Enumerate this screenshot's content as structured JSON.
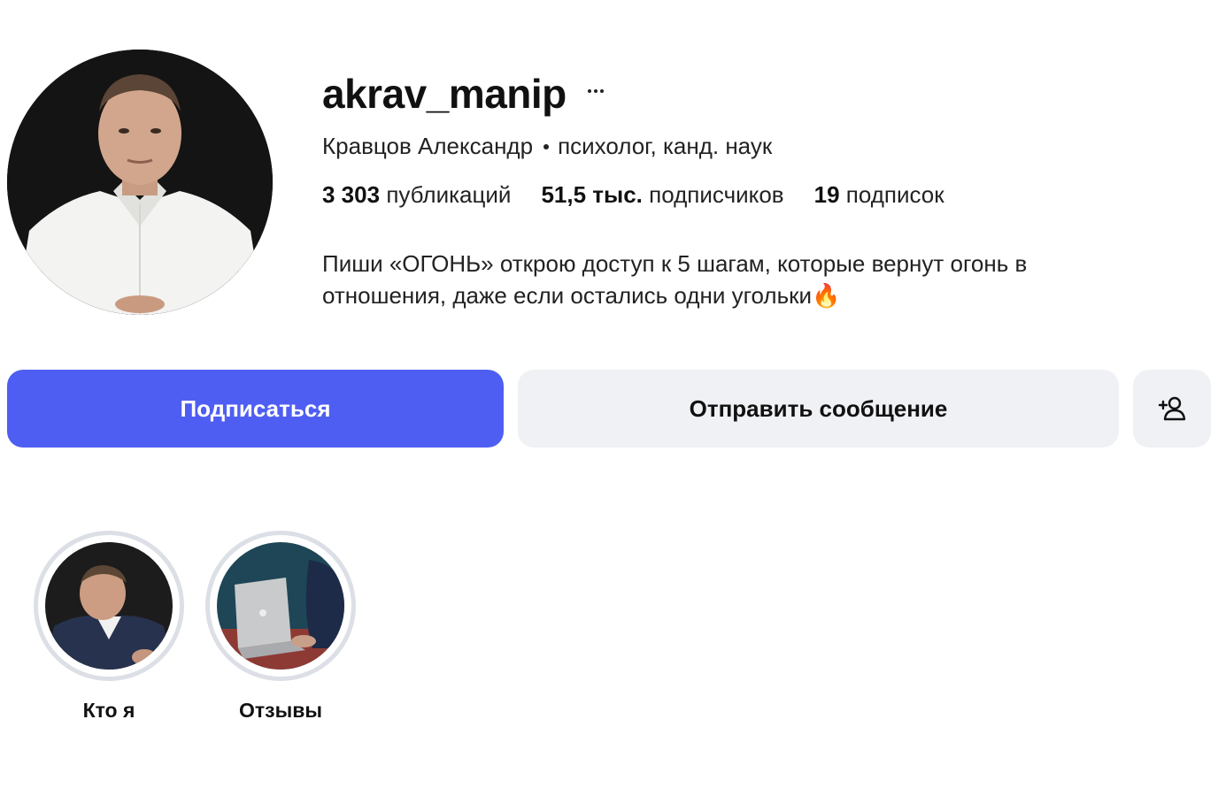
{
  "profile": {
    "username": "akrav_manip",
    "full_name": "Кравцов Александр",
    "category": "психолог, канд. наук",
    "stats": [
      {
        "value": "3 303",
        "label": "публикаций"
      },
      {
        "value": "51,5 тыс.",
        "label": "подписчиков"
      },
      {
        "value": "19",
        "label": "подписок"
      }
    ],
    "bio_line1": "Пиши «ОГОНЬ» открою доступ к 5 шагам, которые вернут огонь в",
    "bio_line2": "отношения, даже если остались одни угольки🔥"
  },
  "actions": {
    "follow_label": "Подписаться",
    "message_label": "Отправить сообщение",
    "add_user_icon": "add-user-icon",
    "more_icon": "more-dots-icon"
  },
  "highlights": [
    {
      "label": "Кто я"
    },
    {
      "label": "Отзывы"
    }
  ],
  "colors": {
    "accent": "#4f5ef2",
    "secondary_button": "#f0f1f5",
    "highlight_ring": "#dcdfe6",
    "text": "#111111"
  }
}
